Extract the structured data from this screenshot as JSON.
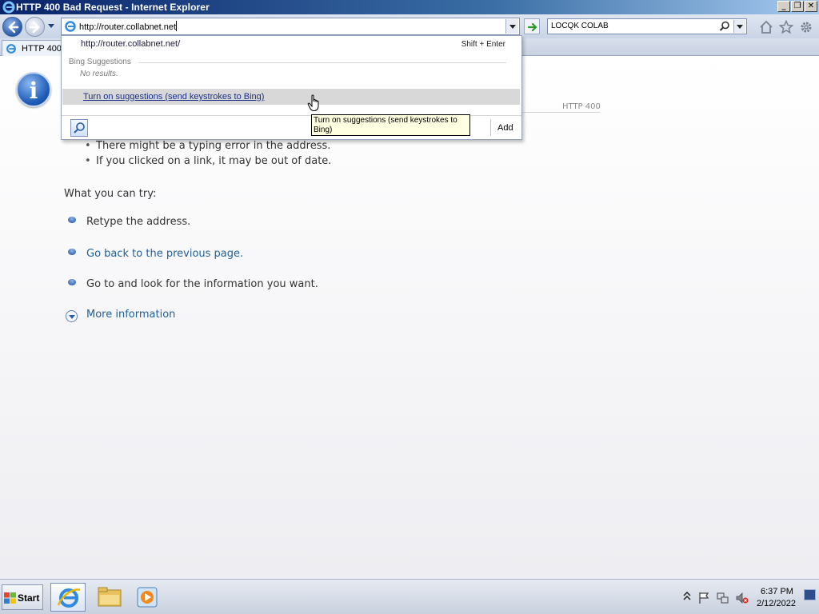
{
  "window": {
    "title": "HTTP 400 Bad Request - Internet Explorer",
    "minimize_glyph": "_",
    "restore_glyph": "❐",
    "close_glyph": "✕"
  },
  "navbar": {
    "address_value": "http://router.collabnet.net",
    "search_value": "LOCQK COLAB",
    "icons": [
      "back-arrow-icon",
      "forward-arrow-icon",
      "go-arrow-icon",
      "search-icon",
      "home-icon",
      "favorites-star-icon",
      "tools-gear-icon"
    ]
  },
  "tab": {
    "label": "HTTP 400"
  },
  "dropdown": {
    "url_suggestion": "http://router.collabnet.net/",
    "shortcut": "Shift + Enter",
    "section_label": "Bing Suggestions",
    "no_results": "No results.",
    "turn_on_link": "Turn on suggestions (send keystrokes to Bing)",
    "add_label": "Add"
  },
  "tooltip": {
    "text": "Turn on suggestions (send keystrokes to Bing)"
  },
  "page": {
    "http_code": "HTTP 400",
    "bullet_1": "There might be a typing error in the address.",
    "bullet_2": "If you clicked on a link, it may be out of date.",
    "bullet_glyph": "•",
    "try_heading": "What you can try:",
    "try_1": "Retype the address.",
    "try_2": "Go back to the previous page.",
    "try_3": "Go to  and look for the information you want.",
    "more_info": "More information",
    "info_glyph": "i"
  },
  "taskbar": {
    "start_label": "Start",
    "time": "6:37 PM",
    "date": "2/12/2022",
    "pinned_apps": [
      "internet-explorer",
      "windows-explorer",
      "windows-media-player"
    ]
  },
  "colors": {
    "link": "#1f5f9a",
    "titlebar": "#0a246a",
    "tooltip_bg": "#ffffe1",
    "selection_row": "#d8d8d8"
  }
}
